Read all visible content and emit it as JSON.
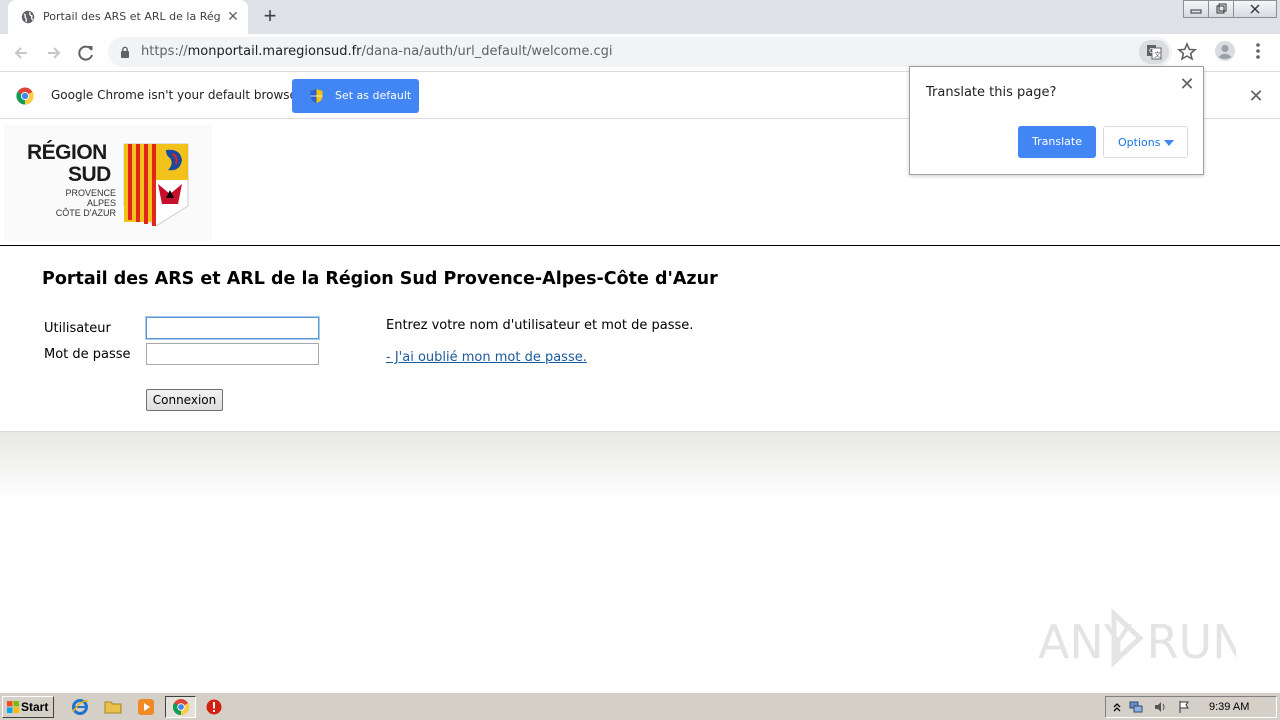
{
  "browser": {
    "tab_title": "Portail des ARS et ARL de la Région",
    "url_scheme": "https://",
    "url_host": "monportail.maregionsud.fr",
    "url_path": "/dana-na/auth/url_default/welcome.cgi"
  },
  "infobar": {
    "message": "Google Chrome isn't your default browser",
    "set_default_label": "Set as default"
  },
  "translate_bubble": {
    "question": "Translate this page?",
    "translate_label": "Translate",
    "options_label": "Options"
  },
  "logo": {
    "line1": "RÉGION",
    "line2": "SUD",
    "sub1": "PROVENCE",
    "sub2": "ALPES",
    "sub3": "CÔTE D'AZUR"
  },
  "page": {
    "title": "Portail des ARS et ARL de la Région Sud Provence-Alpes-Côte d'Azur",
    "username_label": "Utilisateur",
    "password_label": "Mot de passe",
    "username_value": "",
    "password_value": "",
    "login_button": "Connexion",
    "hint": "Entrez votre nom d'utilisateur et mot de passe.",
    "forgot_link": "- J'ai oublié mon mot de passe."
  },
  "watermark": "ANY RUN",
  "taskbar": {
    "start_label": "Start",
    "clock": "9:39 AM"
  },
  "colors": {
    "chrome_blue": "#4285f4",
    "link_blue": "#1a5a9c",
    "tabstrip": "#dee1e6"
  }
}
